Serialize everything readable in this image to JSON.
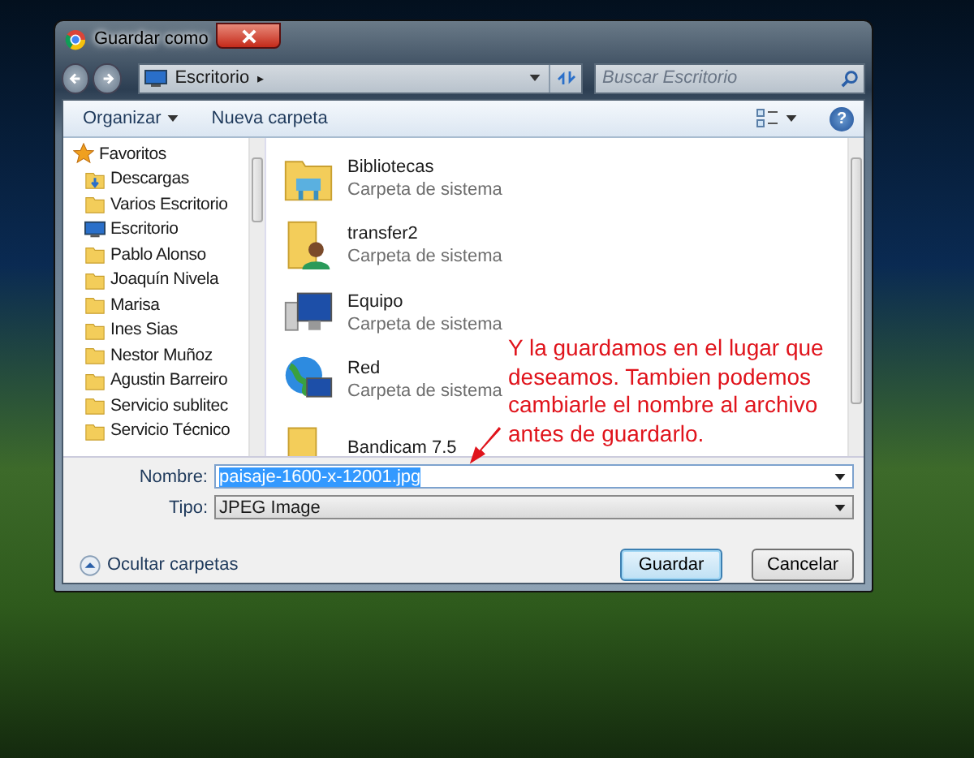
{
  "window": {
    "title": "Guardar como"
  },
  "address_bar": {
    "location": "Escritorio",
    "separator": "▸"
  },
  "search": {
    "placeholder": "Buscar Escritorio"
  },
  "toolbar": {
    "organize": "Organizar",
    "new_folder": "Nueva carpeta",
    "help": "?"
  },
  "sidebar": {
    "items": [
      {
        "label": "Favoritos",
        "kind": "favorites"
      },
      {
        "label": "Descargas",
        "kind": "downloads"
      },
      {
        "label": "Varios Escritorio",
        "kind": "folder"
      },
      {
        "label": "Escritorio",
        "kind": "desktop"
      },
      {
        "label": "Pablo Alonso",
        "kind": "folder"
      },
      {
        "label": "Joaquín Nivela",
        "kind": "folder"
      },
      {
        "label": "Marisa",
        "kind": "folder"
      },
      {
        "label": "Ines Sias",
        "kind": "folder"
      },
      {
        "label": "Nestor Muñoz",
        "kind": "folder"
      },
      {
        "label": "Agustin Barreiro",
        "kind": "folder"
      },
      {
        "label": "Servicio sublitec",
        "kind": "folder"
      },
      {
        "label": "Servicio Técnico",
        "kind": "folder"
      }
    ]
  },
  "files": [
    {
      "name": "Bibliotecas",
      "type": "Carpeta de sistema",
      "kind": "library"
    },
    {
      "name": "transfer2",
      "type": "Carpeta de sistema",
      "kind": "user"
    },
    {
      "name": "Equipo",
      "type": "Carpeta de sistema",
      "kind": "computer"
    },
    {
      "name": "Red",
      "type": "Carpeta de sistema",
      "kind": "network"
    },
    {
      "name": "Bandicam 7.5",
      "kind": "folder"
    }
  ],
  "form": {
    "name_label": "Nombre:",
    "name_value": "paisaje-1600-x-12001.jpg",
    "name_selected": true,
    "type_label": "Tipo:",
    "type_value": "JPEG Image"
  },
  "footer": {
    "hide_folders": "Ocultar carpetas",
    "save": "Guardar",
    "cancel": "Cancelar"
  },
  "annotation": {
    "text": "Y la guardamos en el lugar que deseamos. Tambien podemos cambiarle el nombre al archivo antes de guardarlo."
  }
}
